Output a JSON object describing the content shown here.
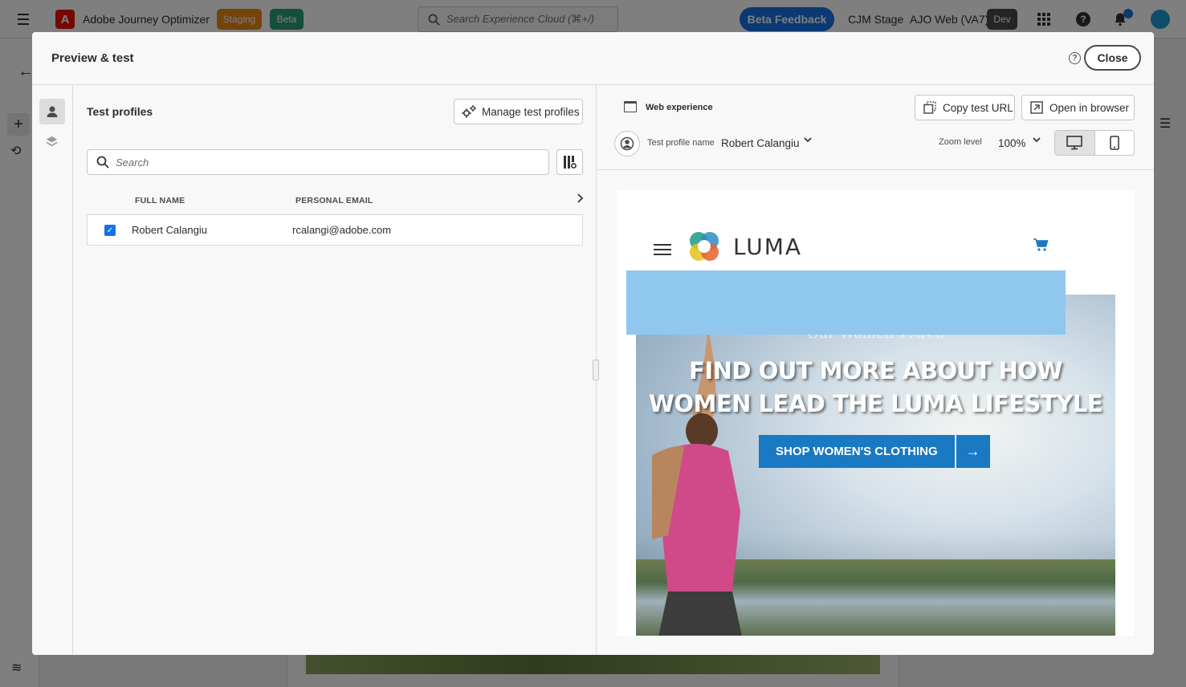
{
  "topbar": {
    "app_name": "Adobe Journey Optimizer",
    "logo_letter": "A",
    "badge_staging": "Staging",
    "badge_beta": "Beta",
    "search_placeholder": "Search Experience Cloud (⌘+/)",
    "beta_feedback": "Beta Feedback",
    "org": "CJM Stage",
    "sandbox": "AJO Web (VA7)",
    "env_badge": "Dev",
    "help_glyph": "?"
  },
  "dialog": {
    "title": "Preview & test",
    "close_label": "Close",
    "help_glyph": "?"
  },
  "test_profiles": {
    "title": "Test profiles",
    "manage_label": "Manage test profiles",
    "search_placeholder": "Search",
    "columns": [
      "FULL NAME",
      "PERSONAL EMAIL"
    ],
    "rows": [
      {
        "full_name": "Robert Calangiu",
        "email": "rcalangi@adobe.com",
        "selected": true
      }
    ]
  },
  "preview": {
    "channel_label": "Web experience",
    "copy_url_label": "Copy test URL",
    "open_browser_label": "Open in browser",
    "profile_label": "Test profile name",
    "profile_value": "Robert Calangiu",
    "zoom_label": "Zoom level",
    "zoom_value": "100%",
    "device_selected": "desktop"
  },
  "site": {
    "brand": "LUMA",
    "hero_subtitle": "Our Women's Area",
    "hero_heading_line1": "FIND OUT MORE ABOUT HOW",
    "hero_heading_line2": "WOMEN LEAD THE LUMA LIFESTYLE",
    "cta_label": "SHOP WOMEN'S CLOTHING",
    "cta_arrow": "→"
  },
  "colors": {
    "accent": "#1473e6",
    "staging": "#e68619",
    "beta": "#2d9d78",
    "dev": "#4b4b4b",
    "luma_blue": "#1979c3",
    "highlight_overlay": "#8fc7ef"
  },
  "icons": {
    "menu": "hamburger-icon",
    "search": "search-icon",
    "apps": "apps-grid-icon",
    "help": "help-icon",
    "notifications": "bell-icon",
    "gear": "gear-icon",
    "column_settings": "column-settings-icon",
    "chevron": "chevron-down-icon",
    "desktop": "desktop-icon",
    "mobile": "mobile-icon",
    "cart": "cart-icon"
  }
}
